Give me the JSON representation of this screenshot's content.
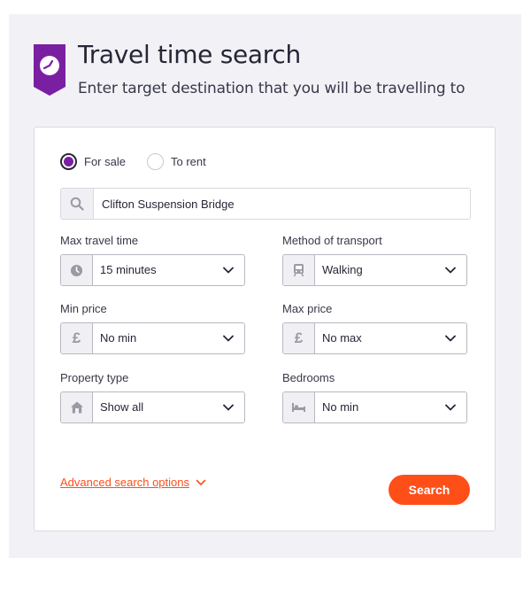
{
  "header": {
    "title": "Travel time search",
    "subtitle": "Enter target destination that you will be travelling to"
  },
  "listing_type": {
    "options": [
      {
        "label": "For sale",
        "selected": true
      },
      {
        "label": "To rent",
        "selected": false
      }
    ]
  },
  "search": {
    "value": "Clifton Suspension Bridge",
    "icon": "search-icon"
  },
  "fields": {
    "max_travel_time": {
      "label": "Max travel time",
      "value": "15 minutes",
      "icon": "clock-icon"
    },
    "method_of_transport": {
      "label": "Method of transport",
      "value": "Walking",
      "icon": "train-icon"
    },
    "min_price": {
      "label": "Min price",
      "value": "No min",
      "icon": "pound-icon",
      "symbol": "£"
    },
    "max_price": {
      "label": "Max price",
      "value": "No max",
      "icon": "pound-icon",
      "symbol": "£"
    },
    "property_type": {
      "label": "Property type",
      "value": "Show all",
      "icon": "house-icon"
    },
    "bedrooms": {
      "label": "Bedrooms",
      "value": "No min",
      "icon": "bed-icon"
    }
  },
  "footer": {
    "advanced_label": "Advanced search options",
    "search_button": "Search"
  },
  "colors": {
    "brand_purple": "#7b1fa2",
    "accent_orange": "#ff4f19",
    "panel_bg": "#f2f2f6"
  }
}
